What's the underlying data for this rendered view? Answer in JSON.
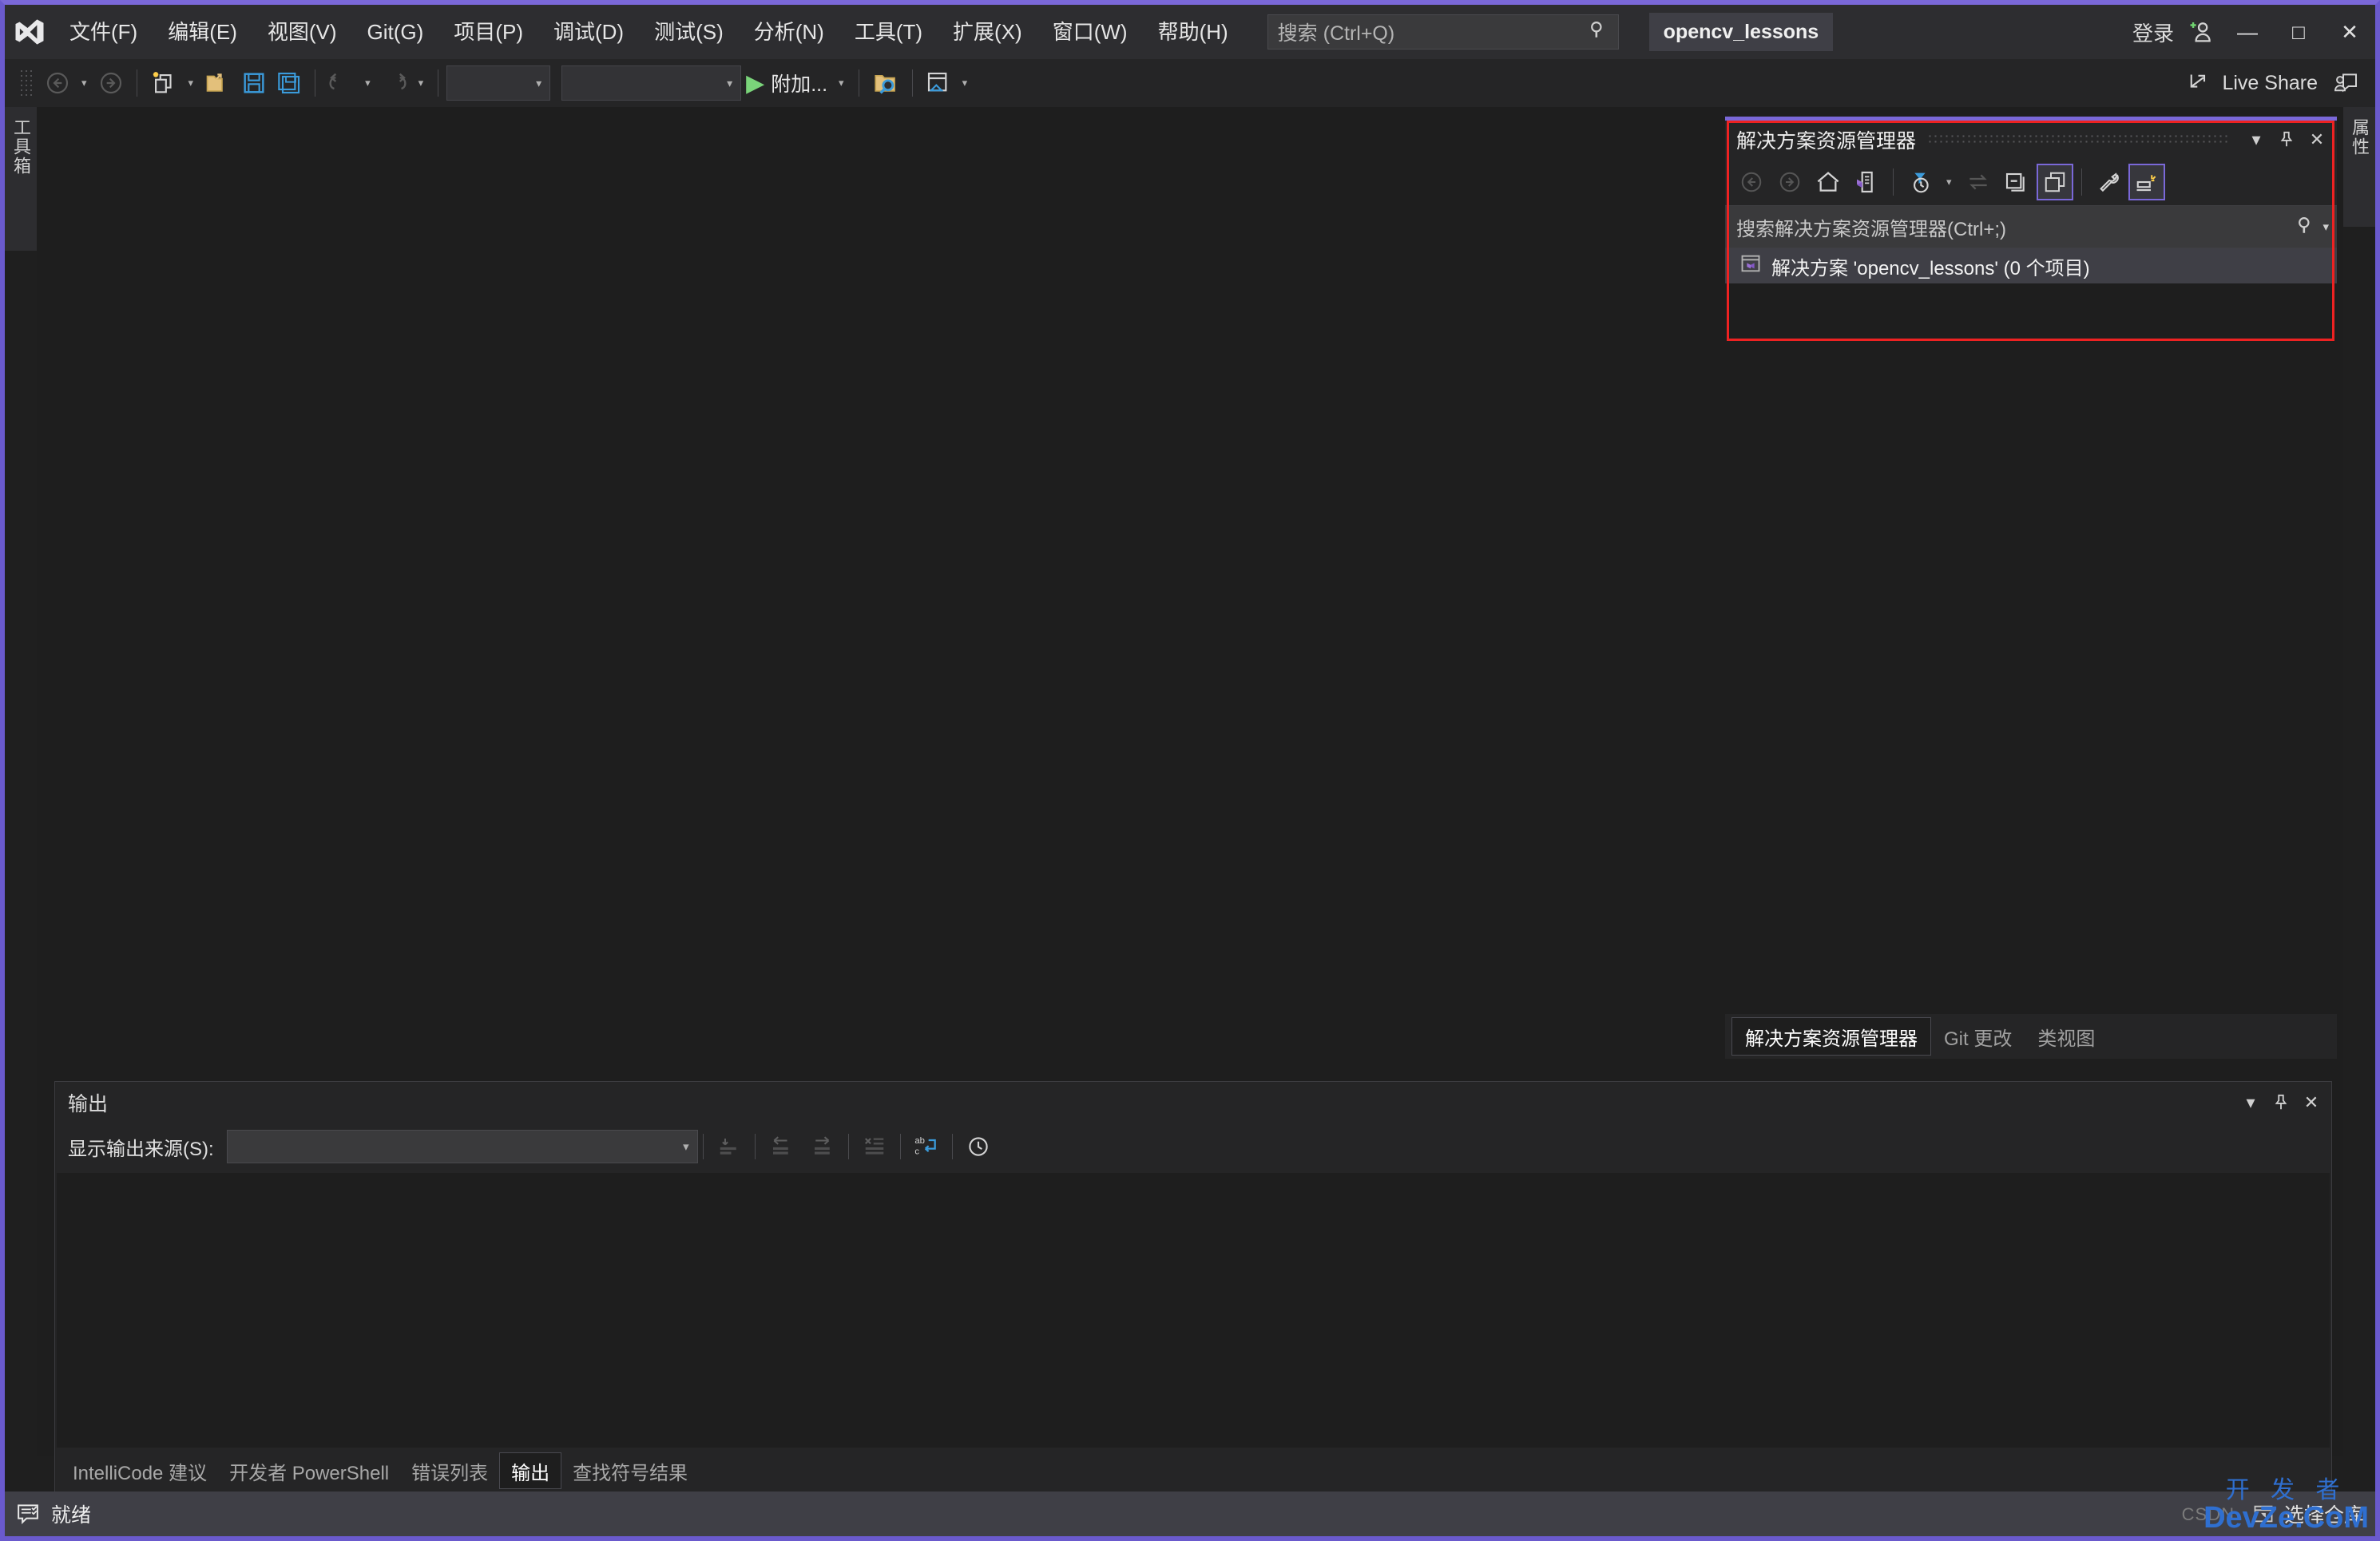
{
  "window": {
    "project_name": "opencv_lessons",
    "accent_color": "#6a5acd",
    "minimize": "—",
    "maximize": "□",
    "close": "✕",
    "signin_label": "登录"
  },
  "menubar": {
    "items": [
      {
        "label": "文件(F)"
      },
      {
        "label": "编辑(E)"
      },
      {
        "label": "视图(V)"
      },
      {
        "label": "Git(G)"
      },
      {
        "label": "项目(P)"
      },
      {
        "label": "调试(D)"
      },
      {
        "label": "测试(S)"
      },
      {
        "label": "分析(N)"
      },
      {
        "label": "工具(T)"
      },
      {
        "label": "扩展(X)"
      },
      {
        "label": "窗口(W)"
      },
      {
        "label": "帮助(H)"
      }
    ]
  },
  "search": {
    "placeholder": "搜索 (Ctrl+Q)",
    "icon": "search-icon"
  },
  "toolbar": {
    "attach_label": "附加...",
    "live_share_label": "Live Share",
    "combo1_value": "",
    "combo2_value": ""
  },
  "toolbox_tab": {
    "label": "工具箱"
  },
  "properties_tab": {
    "label": "属性"
  },
  "solution_explorer": {
    "title": "解决方案资源管理器",
    "search_placeholder": "搜索解决方案资源管理器(Ctrl+;)",
    "root_node": "解决方案 'opencv_lessons' (0 个项目)",
    "tabs": [
      {
        "label": "解决方案资源管理器",
        "active": true
      },
      {
        "label": "Git 更改",
        "active": false
      },
      {
        "label": "类视图",
        "active": false
      }
    ],
    "highlight_color": "#ee2222"
  },
  "output": {
    "title": "输出",
    "source_label": "显示输出来源(S):",
    "source_value": "",
    "tabs": [
      {
        "label": "IntelliCode 建议",
        "active": false
      },
      {
        "label": "开发者 PowerShell",
        "active": false
      },
      {
        "label": "错误列表",
        "active": false
      },
      {
        "label": "输出",
        "active": true
      },
      {
        "label": "查找符号结果",
        "active": false
      }
    ]
  },
  "statusbar": {
    "ready_label": "就绪",
    "repo_label": "选择仓库",
    "ghost_text": "CSDN"
  },
  "watermark": {
    "line1": "开 发 者",
    "line2": "DevZe.CoM"
  }
}
